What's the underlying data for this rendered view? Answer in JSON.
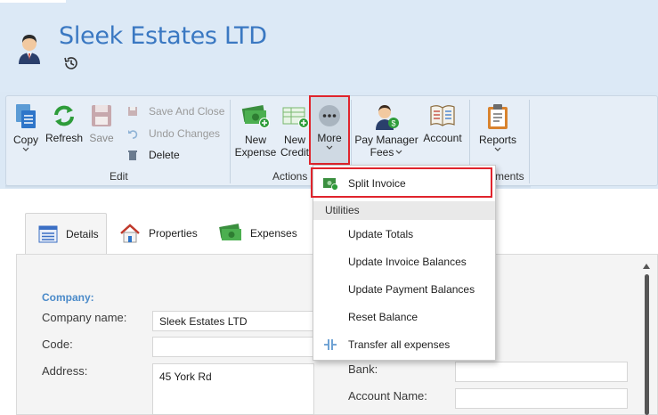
{
  "header": {
    "title": "Sleek Estates LTD"
  },
  "ribbon": {
    "edit_group": {
      "label": "Edit",
      "copy": "Copy",
      "refresh": "Refresh",
      "save": "Save",
      "save_and_close": "Save And Close",
      "undo_changes": "Undo Changes",
      "delete": "Delete"
    },
    "actions_group": {
      "label": "Actions",
      "new_expense_line1": "New",
      "new_expense_line2": "Expense",
      "new_credit_line1": "New",
      "new_credit_line2": "Credit",
      "more": "More"
    },
    "pay_manager_fees_line1": "Pay Manager",
    "pay_manager_fees_line2": "Fees",
    "account": "Account",
    "reports": "Reports",
    "reports_group_label_partial": "ments"
  },
  "menu": {
    "split_invoice": "Split Invoice",
    "utilities_header": "Utilities",
    "update_totals": "Update Totals",
    "update_invoice_balances": "Update Invoice Balances",
    "update_payment_balances": "Update Payment Balances",
    "reset_balance": "Reset Balance",
    "transfer_all_expenses": "Transfer all expenses"
  },
  "tabs": {
    "details": "Details",
    "properties": "Properties",
    "expenses": "Expenses"
  },
  "form": {
    "section_title": "Company:",
    "company_name_label": "Company name:",
    "company_name_value": "Sleek Estates LTD",
    "code_label": "Code:",
    "code_value": "",
    "address_label": "Address:",
    "address_value": "45 York Rd",
    "bank_label": "Bank:",
    "bank_value": "",
    "account_name_label": "Account Name:",
    "account_name_value": ""
  },
  "colors": {
    "title_blue": "#3a78c2",
    "highlight_red": "#e0242c",
    "ribbon_bg": "#e6eef7",
    "section_blue": "#4a8ac9"
  }
}
